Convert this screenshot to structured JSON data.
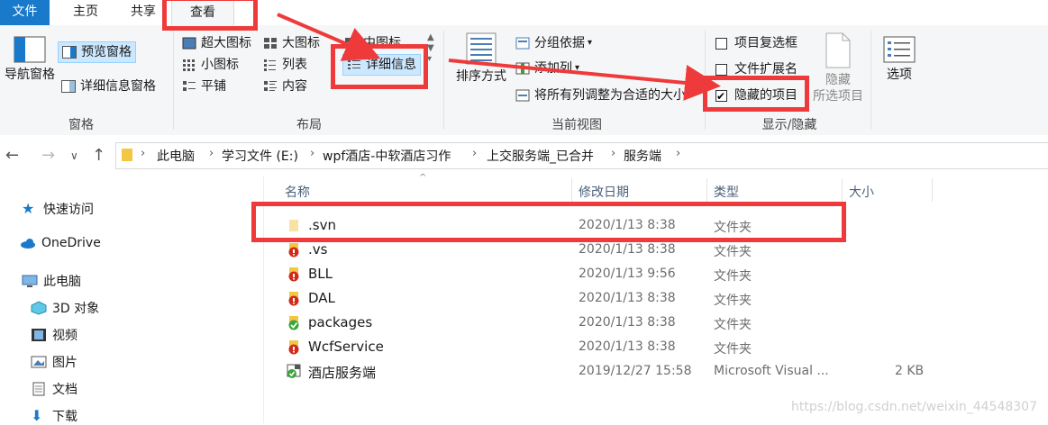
{
  "tabs": {
    "file": "文件",
    "home": "主页",
    "share": "共享",
    "view": "查看"
  },
  "ribbon": {
    "pane_group": {
      "nav_pane": "导航窗格",
      "preview_pane": "预览窗格",
      "details_pane": "详细信息窗格",
      "label": "窗格"
    },
    "layout_group": {
      "extra_large_icons": "超大图标",
      "large_icons": "大图标",
      "medium_icons": "中图标",
      "small_icons": "小图标",
      "list": "列表",
      "details": "详细信息",
      "tiles": "平铺",
      "content": "内容",
      "label": "布局"
    },
    "current_view_group": {
      "sort_by": "排序方式",
      "group_by": "分组依据",
      "add_columns": "添加列",
      "size_all_columns": "将所有列调整为合适的大小",
      "label": "当前视图"
    },
    "show_hide_group": {
      "item_checkboxes": "项目复选框",
      "file_extensions": "文件扩展名",
      "hidden_items": "隐藏的项目",
      "hide_selected_line1": "隐藏",
      "hide_selected_line2": "所选项目",
      "label": "显示/隐藏",
      "item_checkboxes_checked": false,
      "file_extensions_checked": false,
      "hidden_items_checked": true
    },
    "options": "选项"
  },
  "breadcrumb": [
    "此电脑",
    "学习文件 (E:)",
    "wpf酒店-中软酒店习作",
    "上交服务端_已合并",
    "服务端"
  ],
  "sidebar": {
    "quick_access": "快速访问",
    "onedrive": "OneDrive",
    "this_pc": "此电脑",
    "objects3d": "3D 对象",
    "videos": "视频",
    "pictures": "图片",
    "documents": "文档",
    "downloads": "下载"
  },
  "columns": {
    "name": "名称",
    "date": "修改日期",
    "type": "类型",
    "size": "大小"
  },
  "files": [
    {
      "name": ".svn",
      "date": "2020/1/13 8:38",
      "type": "文件夹",
      "size": "",
      "icon": "folder-icon"
    },
    {
      "name": ".vs",
      "date": "2020/1/13 8:38",
      "type": "文件夹",
      "size": "",
      "icon": "svn-conflict-folder-icon"
    },
    {
      "name": "BLL",
      "date": "2020/1/13 9:56",
      "type": "文件夹",
      "size": "",
      "icon": "svn-conflict-folder-icon"
    },
    {
      "name": "DAL",
      "date": "2020/1/13 8:38",
      "type": "文件夹",
      "size": "",
      "icon": "svn-conflict-folder-icon"
    },
    {
      "name": "packages",
      "date": "2020/1/13 8:38",
      "type": "文件夹",
      "size": "",
      "icon": "svn-ok-folder-icon"
    },
    {
      "name": "WcfService",
      "date": "2020/1/13 8:38",
      "type": "文件夹",
      "size": "",
      "icon": "svn-conflict-folder-icon"
    },
    {
      "name": "酒店服务端",
      "date": "2019/12/27 15:58",
      "type": "Microsoft Visual ...",
      "size": "2 KB",
      "icon": "vs-solution-icon"
    }
  ],
  "watermark": "https://blog.csdn.net/weixin_44548307",
  "colors": {
    "accent": "#1979ca",
    "annotation_red": "#ee3a3a",
    "selection": "#cce8ff"
  }
}
